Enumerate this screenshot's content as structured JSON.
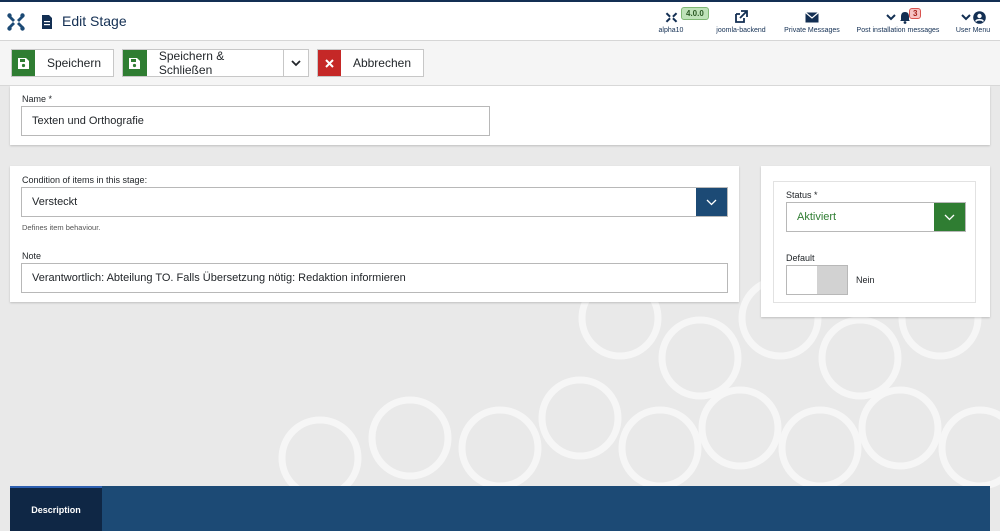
{
  "header": {
    "title": "Edit Stage",
    "version": "4.0.0",
    "items": {
      "site": "alpha10",
      "joomla": "joomla-backend",
      "messages": "Private Messages",
      "post_install": "Post installation messages",
      "user": "User Menu"
    },
    "notification_count": "3",
    "accent": "#132f53"
  },
  "toolbar": {
    "save": "Speichern",
    "save_close": "Speichern & Schließen",
    "cancel": "Abbrechen",
    "icons": {
      "save": "floppy-icon",
      "cancel": "times-icon"
    }
  },
  "form": {
    "name_label": "Name *",
    "name_value": "Texten und Orthografie",
    "condition_label": "Condition of items in this stage:",
    "condition_value": "Versteckt",
    "condition_help": "Defines item behaviour.",
    "note_label": "Note",
    "note_value": "Verantwortlich: Abteilung TO. Falls Übersetzung nötig: Redaktion informieren"
  },
  "sidebar": {
    "status_label": "Status *",
    "status_value": "Aktiviert",
    "status_color": "#2f7d32",
    "default_label": "Default",
    "default_value": "Nein"
  },
  "bottom": {
    "tab_label": "Description"
  }
}
